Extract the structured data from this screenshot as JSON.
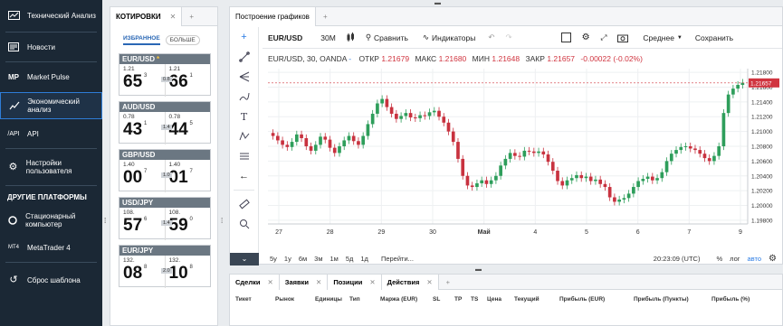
{
  "sidebar": {
    "items": [
      {
        "icon": "trending-icon",
        "label": "Технический Анализ"
      },
      {
        "icon": "news-icon",
        "label": "Новости"
      },
      {
        "icon": "mp-icon",
        "label": "Market Pulse"
      },
      {
        "icon": "calendar-line-icon",
        "label": "Экономический анализ"
      },
      {
        "icon": "api-icon",
        "label": "API"
      },
      {
        "icon": "gear-icon",
        "label": "Настройки пользователя"
      }
    ],
    "platforms_heading": "ДРУГИЕ ПЛАТФОРМЫ",
    "platforms": [
      {
        "icon": "desktop-icon",
        "label": "Стационарный компьютер"
      },
      {
        "icon": "mt4-icon",
        "label": "MetaTrader 4"
      }
    ],
    "reset": {
      "icon": "reset-icon",
      "label": "Сброс шаблона"
    }
  },
  "quotes": {
    "tab": "КОТИРОВКИ",
    "close": "✕",
    "plus": "+",
    "fav_tab": "ИЗБРАННОЕ",
    "more_tab": "БОЛЬШЕ",
    "cards": [
      {
        "pair": "EUR/USD",
        "star": "*",
        "bid_base": "1.21",
        "bid_big": "65",
        "bid_sup": "3",
        "ask_base": "1.21",
        "ask_big": "66",
        "ask_sup": "1",
        "spread": "0.8"
      },
      {
        "pair": "AUD/USD",
        "star": "",
        "bid_base": "0.78",
        "bid_big": "43",
        "bid_sup": "1",
        "ask_base": "0.78",
        "ask_big": "44",
        "ask_sup": "5",
        "spread": "1.4"
      },
      {
        "pair": "GBP/USD",
        "star": "",
        "bid_base": "1.40",
        "bid_big": "00",
        "bid_sup": "7",
        "ask_base": "1.40",
        "ask_big": "01",
        "ask_sup": "7",
        "spread": "1.0"
      },
      {
        "pair": "USD/JPY",
        "star": "",
        "bid_base": "108.",
        "bid_big": "57",
        "bid_sup": "6",
        "ask_base": "108.",
        "ask_big": "59",
        "ask_sup": "0",
        "spread": "1.4"
      },
      {
        "pair": "EUR/JPY",
        "star": "",
        "bid_base": "132.",
        "bid_big": "08",
        "bid_sup": "8",
        "ask_base": "132.",
        "ask_big": "10",
        "ask_sup": "8",
        "spread": "2.0"
      }
    ]
  },
  "chart": {
    "tab": "Построение графиков",
    "plus": "+",
    "toolbar": {
      "symbol": "EUR/USD",
      "interval": "30M",
      "compare": "Сравнить",
      "indicators": "Индикаторы",
      "price_type": "Среднее",
      "save": "Сохранить"
    },
    "legend": {
      "title": "EUR/USD, 30, OANDA",
      "dash": "-",
      "open_label": "ОТКР",
      "open": "1.21679",
      "high_label": "МАКС",
      "high": "1.21680",
      "low_label": "МИН",
      "low": "1.21648",
      "close_label": "ЗАКР",
      "close": "1.21657",
      "change": "-0.00022 (-0.02%)"
    },
    "timeframes": [
      "5y",
      "1y",
      "6м",
      "3м",
      "1м",
      "5д",
      "1д"
    ],
    "goto": "Перейти...",
    "time": "20:23:09 (UTC)",
    "pct": "%",
    "log": "лог",
    "auto": "авто"
  },
  "chart_data": {
    "type": "candlestick",
    "title": "EUR/USD, 30, OANDA",
    "x_ticks": [
      "27",
      "28",
      "29",
      "30",
      "Май",
      "4",
      "5",
      "6",
      "7",
      "9"
    ],
    "y_ticks": [
      "1.21800",
      "1.21600",
      "1.21400",
      "1.21200",
      "1.21000",
      "1.20800",
      "1.20600",
      "1.20400",
      "1.20200",
      "1.20000",
      "1.19800"
    ],
    "ylim": [
      1.1975,
      1.2185
    ],
    "last_price": "1.21657",
    "close_series": [
      1.2094,
      1.2088,
      1.2082,
      1.2079,
      1.2086,
      1.2096,
      1.2091,
      1.208,
      1.2074,
      1.2082,
      1.2093,
      1.2089,
      1.2078,
      1.2071,
      1.208,
      1.2088,
      1.2094,
      1.2087,
      1.2082,
      1.2094,
      1.211,
      1.2124,
      1.2138,
      1.2144,
      1.2133,
      1.2124,
      1.2117,
      1.2121,
      1.2125,
      1.2119,
      1.2118,
      1.2122,
      1.2121,
      1.2126,
      1.2128,
      1.212,
      1.2112,
      1.21,
      1.2086,
      1.2063,
      1.204,
      1.2027,
      1.2025,
      1.203,
      1.2034,
      1.2029,
      1.2034,
      1.204,
      1.2054,
      1.2063,
      1.2071,
      1.2067,
      1.2066,
      1.2074,
      1.2073,
      1.2071,
      1.2073,
      1.2069,
      1.2059,
      1.2047,
      1.2033,
      1.2027,
      1.2034,
      1.2037,
      1.2041,
      1.2037,
      1.2039,
      1.2033,
      1.2035,
      1.2029,
      1.2025,
      1.2011,
      1.2005,
      1.2008,
      1.201,
      1.2016,
      1.2025,
      1.2033,
      1.2036,
      1.2039,
      1.2034,
      1.2037,
      1.2045,
      1.206,
      1.207,
      1.2075,
      1.2079,
      1.208,
      1.2077,
      1.2075,
      1.207,
      1.2064,
      1.206,
      1.2067,
      1.208,
      1.2125,
      1.215,
      1.2158,
      1.2163,
      1.2166
    ]
  },
  "bottom": {
    "tabs": [
      "Сделки",
      "Заявки",
      "Позиции",
      "Действия"
    ],
    "close": "✕",
    "plus": "+",
    "columns": [
      "Тикет",
      "Рынок",
      "Единицы",
      "Тип",
      "Маржа (EUR)",
      "SL",
      "TP",
      "TS",
      "Цена",
      "Текущий",
      "Прибыль (EUR)",
      "Прибыль (Пункты)",
      "Прибыль (%)"
    ]
  },
  "colors": {
    "up": "#2e9e5b",
    "down": "#c8323f",
    "accent": "#2a7be4",
    "sidebar_bg": "#1b2835"
  }
}
